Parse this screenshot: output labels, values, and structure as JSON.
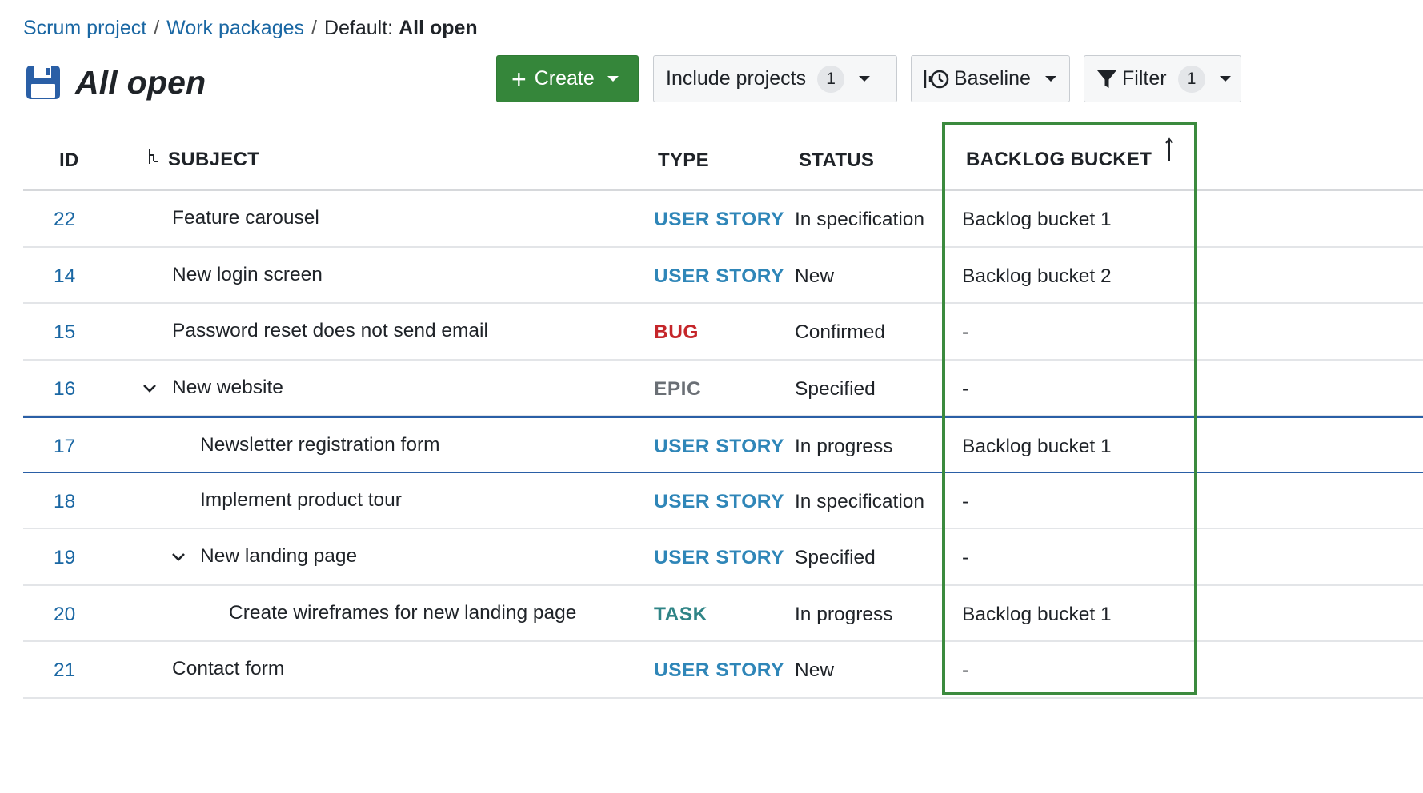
{
  "breadcrumb": {
    "project": "Scrum project",
    "section": "Work packages",
    "prefix": "Default:",
    "current": "All open",
    "separator": "/"
  },
  "page": {
    "title": "All open",
    "icon": "save-icon"
  },
  "toolbar": {
    "create_label": "Create",
    "include_label": "Include projects",
    "include_count": "1",
    "baseline_label": "Baseline",
    "filter_label": "Filter",
    "filter_count": "1"
  },
  "colors": {
    "create_bg": "#35863a",
    "link": "#1a67a3",
    "user_story": "#2f86b8",
    "bug": "#c5262a",
    "epic": "#6a6f75",
    "task": "#2f8486",
    "highlight": "#3b8a3e"
  },
  "table": {
    "columns": {
      "id": "ID",
      "subject": "SUBJECT",
      "type": "TYPE",
      "status": "STATUS",
      "bucket": "BACKLOG BUCKET"
    },
    "rows": [
      {
        "id": "22",
        "subject": "Feature carousel",
        "type": "USER STORY",
        "type_class": "userstory",
        "status": "In specification",
        "bucket": "Backlog bucket 1",
        "level": 0,
        "expandable": false
      },
      {
        "id": "14",
        "subject": "New login screen",
        "type": "USER STORY",
        "type_class": "userstory",
        "status": "New",
        "bucket": "Backlog bucket 2",
        "level": 0,
        "expandable": false
      },
      {
        "id": "15",
        "subject": "Password reset does not send email",
        "type": "BUG",
        "type_class": "bug",
        "status": "Confirmed",
        "bucket": "-",
        "level": 0,
        "expandable": false
      },
      {
        "id": "16",
        "subject": "New website",
        "type": "EPIC",
        "type_class": "epic",
        "status": "Specified",
        "bucket": "-",
        "level": 0,
        "expandable": true
      },
      {
        "id": "17",
        "subject": "Newsletter registration form",
        "type": "USER STORY",
        "type_class": "userstory",
        "status": "In progress",
        "bucket": "Backlog bucket 1",
        "level": 1,
        "expandable": false
      },
      {
        "id": "18",
        "subject": "Implement product tour",
        "type": "USER STORY",
        "type_class": "userstory",
        "status": "In specification",
        "bucket": "-",
        "level": 1,
        "expandable": false
      },
      {
        "id": "19",
        "subject": "New landing page",
        "type": "USER STORY",
        "type_class": "userstory",
        "status": "Specified",
        "bucket": "-",
        "level": 1,
        "expandable": true
      },
      {
        "id": "20",
        "subject": "Create wireframes for new landing page",
        "type": "TASK",
        "type_class": "task",
        "status": "In progress",
        "bucket": "Backlog bucket 1",
        "level": 2,
        "expandable": false
      },
      {
        "id": "21",
        "subject": "Contact form",
        "type": "USER STORY",
        "type_class": "userstory",
        "status": "New",
        "bucket": "-",
        "level": 0,
        "expandable": false
      }
    ]
  }
}
